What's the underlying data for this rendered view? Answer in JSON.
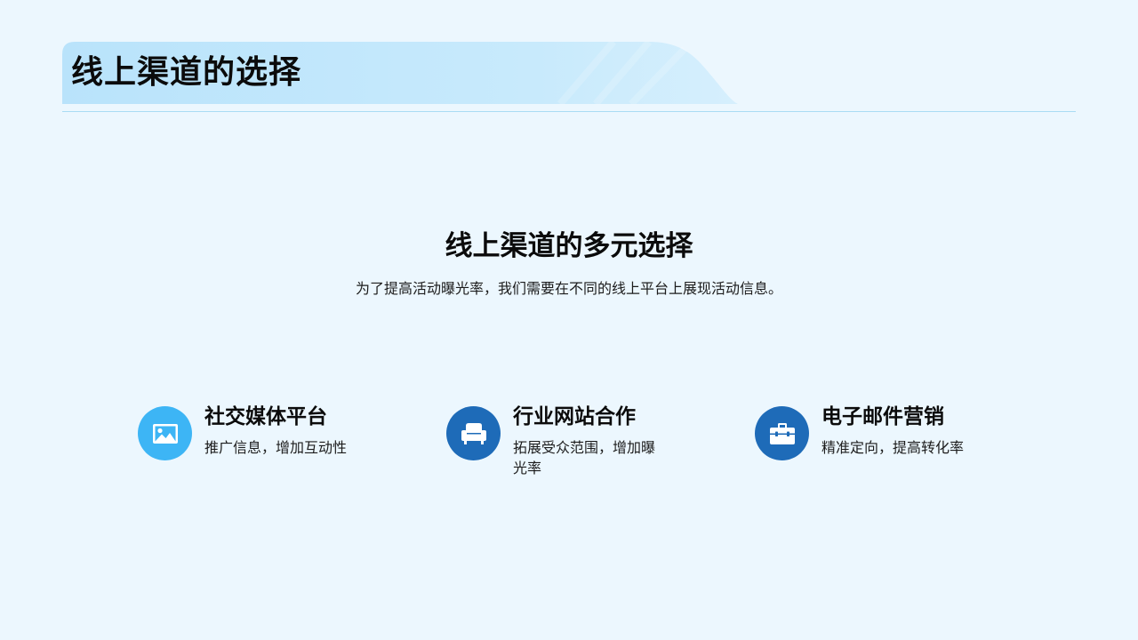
{
  "header": {
    "title": "线上渠道的选择"
  },
  "section": {
    "title": "线上渠道的多元选择",
    "subtitle": "为了提高活动曝光率，我们需要在不同的线上平台上展现活动信息。"
  },
  "features": [
    {
      "title": "社交媒体平台",
      "desc": "推广信息，增加互动性",
      "icon": "image-icon",
      "icon_color": "#3db5f5"
    },
    {
      "title": "行业网站合作",
      "desc": "拓展受众范围，增加曝光率",
      "icon": "sofa-icon",
      "icon_color": "#1e6bb8"
    },
    {
      "title": "电子邮件营销",
      "desc": "精准定向，提高转化率",
      "icon": "toolbox-icon",
      "icon_color": "#1e6bb8"
    }
  ],
  "colors": {
    "background": "#ecf7fe",
    "header_band": "#c4e8fc",
    "rule": "#a9dcf4",
    "accent_light": "#3db5f5",
    "accent_dark": "#1e6bb8"
  }
}
